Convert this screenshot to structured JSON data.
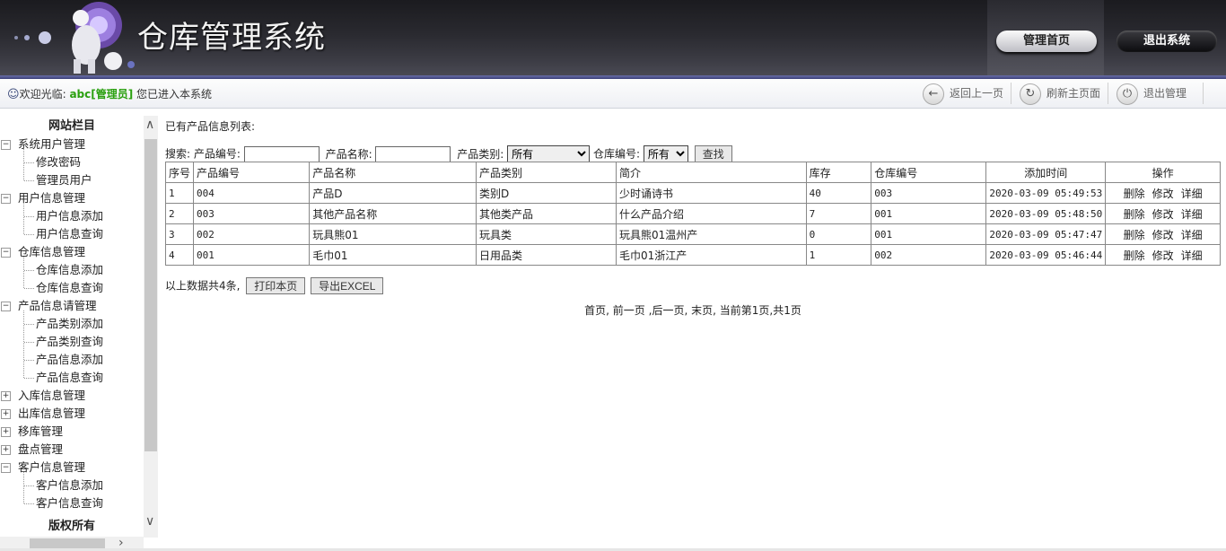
{
  "header": {
    "title": "仓库管理系统",
    "home_button": "管理首页",
    "exit_button": "退出系统",
    "accent": "#3b3f78"
  },
  "welcome": {
    "prefix": "欢迎光临:",
    "user": "abc[管理员]",
    "suffix": "您已进入本系统"
  },
  "quick_actions": [
    {
      "label": "返回上一页",
      "icon": "back-arrow-icon"
    },
    {
      "label": "刷新主页面",
      "icon": "refresh-icon"
    },
    {
      "label": "退出管理",
      "icon": "power-icon"
    }
  ],
  "sidebar": {
    "title": "网站栏目",
    "footer": "版权所有",
    "groups": [
      {
        "label": "系统用户管理",
        "expanded": true,
        "items": [
          "修改密码",
          "管理员用户"
        ]
      },
      {
        "label": "用户信息管理",
        "expanded": true,
        "items": [
          "用户信息添加",
          "用户信息查询"
        ]
      },
      {
        "label": "仓库信息管理",
        "expanded": true,
        "items": [
          "仓库信息添加",
          "仓库信息查询"
        ]
      },
      {
        "label": "产品信息请管理",
        "expanded": true,
        "items": [
          "产品类别添加",
          "产品类别查询",
          "产品信息添加",
          "产品信息查询"
        ]
      },
      {
        "label": "入库信息管理",
        "expanded": false,
        "items": []
      },
      {
        "label": "出库信息管理",
        "expanded": false,
        "items": []
      },
      {
        "label": "移库管理",
        "expanded": false,
        "items": []
      },
      {
        "label": "盘点管理",
        "expanded": false,
        "items": []
      },
      {
        "label": "客户信息管理",
        "expanded": true,
        "items": [
          "客户信息添加",
          "客户信息查询"
        ]
      }
    ]
  },
  "main": {
    "list_title": "已有产品信息列表:",
    "search": {
      "label": "搜索:",
      "product_no_label": "产品编号:",
      "product_no_value": "",
      "product_name_label": "产品名称:",
      "product_name_value": "",
      "category_label": "产品类别:",
      "category_value": "所有",
      "warehouse_label": "仓库编号:",
      "warehouse_value": "所有",
      "search_button": "查找"
    },
    "columns": [
      "序号",
      "产品编号",
      "产品名称",
      "产品类别",
      "简介",
      "库存",
      "仓库编号",
      "添加时间",
      "操作"
    ],
    "rows": [
      {
        "idx": "1",
        "code": "004",
        "name": "产品D",
        "category": "类别D",
        "intro": "少时诵诗书",
        "stock": "40",
        "warehouse": "003",
        "time": "2020-03-09 05:49:53"
      },
      {
        "idx": "2",
        "code": "003",
        "name": "其他产品名称",
        "category": "其他类产品",
        "intro": "什么产品介绍",
        "stock": "7",
        "warehouse": "001",
        "time": "2020-03-09 05:48:50"
      },
      {
        "idx": "3",
        "code": "002",
        "name": "玩具熊01",
        "category": "玩具类",
        "intro": "玩具熊01温州产",
        "stock": "0",
        "warehouse": "001",
        "time": "2020-03-09 05:47:47"
      },
      {
        "idx": "4",
        "code": "001",
        "name": "毛巾01",
        "category": "日用品类",
        "intro": "毛巾01浙江产",
        "stock": "1",
        "warehouse": "002",
        "time": "2020-03-09 05:46:44"
      }
    ],
    "ops": {
      "delete": "删除",
      "edit": "修改",
      "detail": "详细"
    },
    "summary": "以上数据共4条,",
    "print_button": "打印本页",
    "export_button": "导出EXCEL",
    "pager": {
      "first": "首页,",
      "prev": "前一页",
      "next": ",后一页,",
      "last": "末页,",
      "status": "当前第1页,共1页"
    }
  }
}
